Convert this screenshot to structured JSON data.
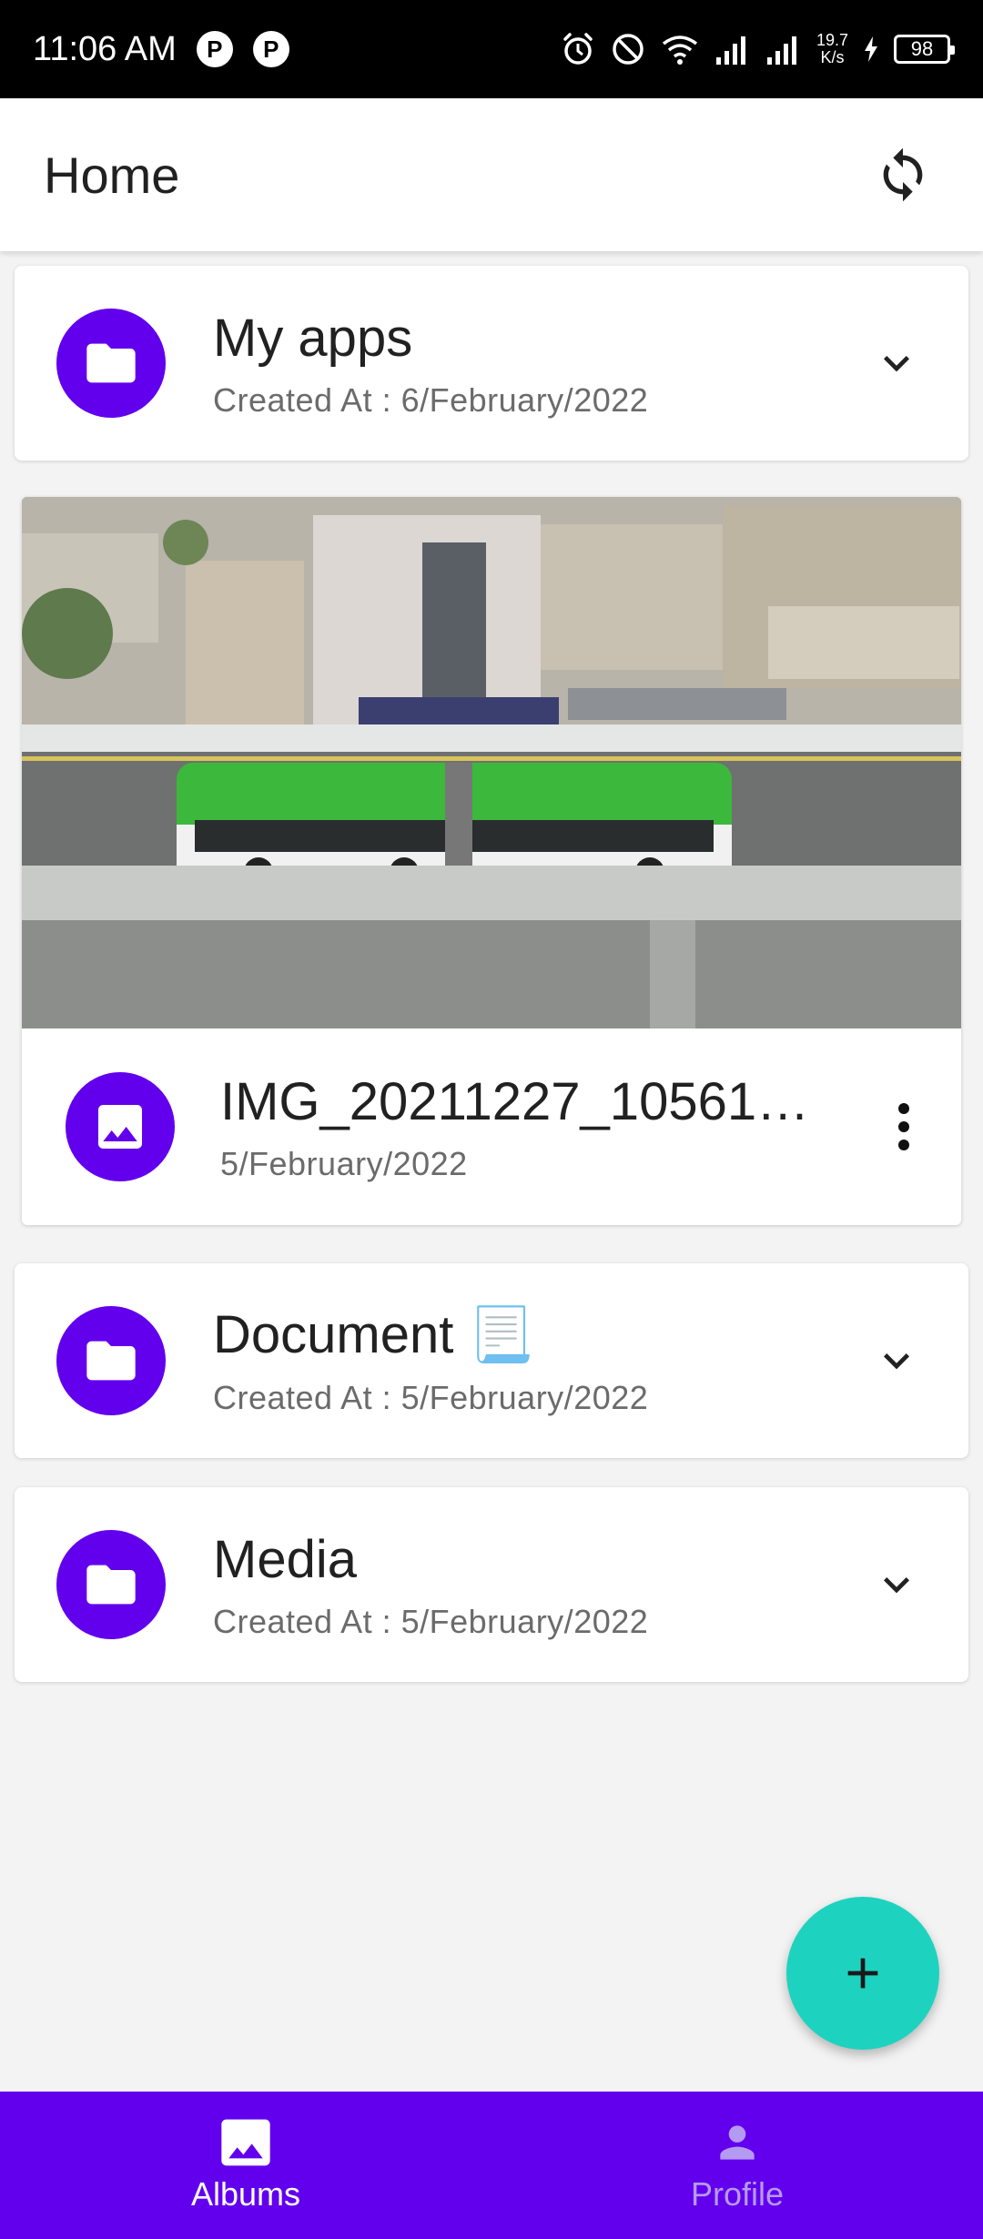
{
  "status_bar": {
    "time": "11:06 AM",
    "notification_icons": [
      "P",
      "P"
    ],
    "net_speed_value": "19.7",
    "net_speed_unit": "K/s",
    "battery": "98",
    "icons": [
      "alarm-icon",
      "do-not-disturb-icon",
      "wifi-icon",
      "signal-icon",
      "signal-icon",
      "charging-icon"
    ]
  },
  "app_bar": {
    "title": "Home",
    "refresh_icon": "refresh-icon"
  },
  "albums": [
    {
      "title": "My apps",
      "subtitle": "Created At : 6/February/2022",
      "icon": "folder-icon"
    },
    {
      "title": "Document 📃",
      "subtitle": "Created At : 5/February/2022",
      "icon": "folder-icon"
    },
    {
      "title": "Media",
      "subtitle": "Created At : 5/February/2022",
      "icon": "folder-icon"
    }
  ],
  "photo_item": {
    "title": "IMG_20211227_10561…",
    "date": "5/February/2022",
    "icon": "image-icon"
  },
  "fab": {
    "icon": "plus-icon"
  },
  "bottom_nav": {
    "items": [
      {
        "label": "Albums",
        "icon": "photo-album-icon",
        "active": true
      },
      {
        "label": "Profile",
        "icon": "person-icon",
        "active": false
      }
    ]
  },
  "colors": {
    "primary": "#6200ee",
    "accent": "#1dd3c0",
    "background": "#f3f3f3",
    "inactive_nav": "#b59af2"
  }
}
